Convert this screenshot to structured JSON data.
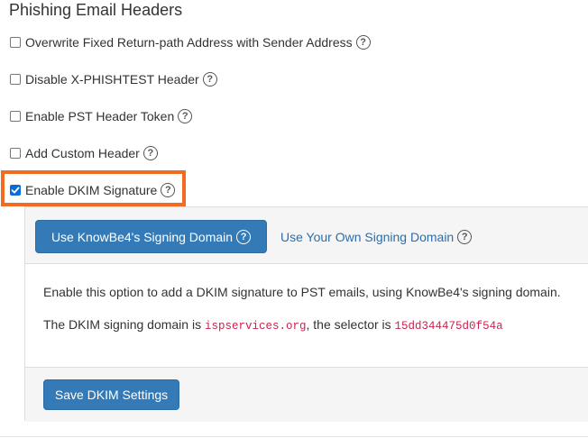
{
  "section": {
    "title": "Phishing Email Headers"
  },
  "options": [
    {
      "label": "Overwrite Fixed Return-path Address with Sender Address",
      "checked": false
    },
    {
      "label": "Disable X-PHISHTEST Header",
      "checked": false
    },
    {
      "label": "Enable PST Header Token",
      "checked": false
    },
    {
      "label": "Add Custom Header",
      "checked": false
    },
    {
      "label": "Enable DKIM Signature",
      "checked": true
    }
  ],
  "help_glyph": "?",
  "dkim": {
    "tabs": {
      "active_label": "Use KnowBe4's Signing Domain",
      "other_label": "Use Your Own Signing Domain"
    },
    "description": "Enable this option to add a DKIM signature to PST emails, using KnowBe4's signing domain.",
    "domain_prefix": "The DKIM signing domain is ",
    "domain": "ispservices.org",
    "selector_prefix": ", the selector is ",
    "selector": "15dd344475d0f54a",
    "save_label": "Save DKIM Settings"
  },
  "colors": {
    "primary": "#337ab7",
    "link": "#2a6ead",
    "highlight": "#f26b21",
    "code": "#c7254e"
  }
}
